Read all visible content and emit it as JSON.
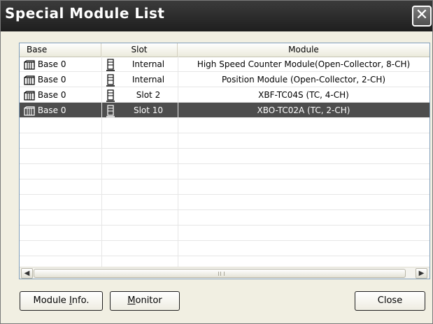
{
  "window": {
    "title": "Special Module List",
    "close_glyph": "✕"
  },
  "table": {
    "columns": [
      "Base",
      "Slot",
      "Module"
    ],
    "rows": [
      {
        "base": "Base 0",
        "slot": "Internal",
        "module": "High Speed Counter Module(Open-Collector, 8-CH)",
        "selected": false
      },
      {
        "base": "Base 0",
        "slot": "Internal",
        "module": "Position Module (Open-Collector, 2-CH)",
        "selected": false
      },
      {
        "base": "Base 0",
        "slot": "Slot 2",
        "module": "XBF-TC04S (TC, 4-CH)",
        "selected": false
      },
      {
        "base": "Base 0",
        "slot": "Slot 10",
        "module": "XBO-TC02A (TC, 2-CH)",
        "selected": true
      }
    ]
  },
  "scrollbar": {
    "left_glyph": "◀",
    "right_glyph": "▶"
  },
  "buttons": {
    "module_info": {
      "pre": "Module ",
      "accel": "I",
      "post": "nfo."
    },
    "monitor": {
      "pre": "",
      "accel": "M",
      "post": "onitor"
    },
    "close": "Close"
  },
  "icons": {
    "base": "base-rack-icon",
    "slot": "slot-card-icon"
  }
}
